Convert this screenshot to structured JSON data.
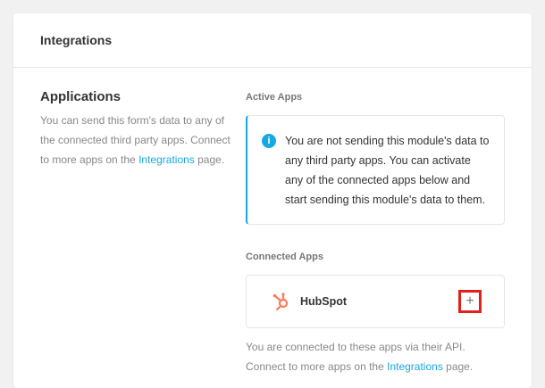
{
  "header": {
    "title": "Integrations"
  },
  "applications": {
    "title": "Applications",
    "desc_prefix": "You can send this form's data to any of the connected third party apps. Connect to more apps on the ",
    "link_text": "Integrations",
    "desc_suffix": " page."
  },
  "active_apps": {
    "label": "Active Apps",
    "notice": "You are not sending this module's data to any third party apps. You can activate any of the connected apps below and start sending this module's data to them.",
    "icon": "info-icon"
  },
  "connected_apps": {
    "label": "Connected Apps",
    "apps": [
      {
        "name": "HubSpot",
        "icon": "hubspot-logo-icon",
        "action_label": "+"
      }
    ],
    "footer_prefix": "You are connected to these apps via their API. Connect to more apps on the ",
    "footer_link": "Integrations",
    "footer_suffix": " page."
  },
  "colors": {
    "accent": "#17a8e3",
    "hubspot": "#ff7a59",
    "highlight": "#e0201a"
  }
}
